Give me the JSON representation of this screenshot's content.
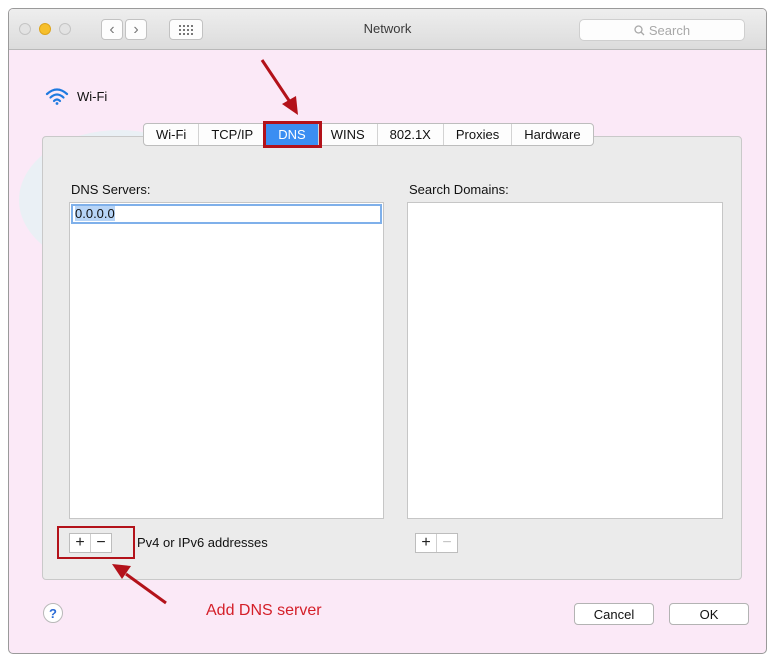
{
  "window": {
    "title": "Network",
    "search_placeholder": "Search",
    "search_icon": "magnifier-icon",
    "back_symbol": "‹",
    "forward_symbol": "›",
    "grid_icon": "grid-icon"
  },
  "header": {
    "interface_name": "Wi-Fi",
    "icon": "wifi-icon"
  },
  "tabs": [
    {
      "label": "Wi-Fi",
      "active": false
    },
    {
      "label": "TCP/IP",
      "active": false
    },
    {
      "label": "DNS",
      "active": true
    },
    {
      "label": "WINS",
      "active": false
    },
    {
      "label": "802.1X",
      "active": false
    },
    {
      "label": "Proxies",
      "active": false
    },
    {
      "label": "Hardware",
      "active": false
    }
  ],
  "dns": {
    "servers_label": "DNS Servers:",
    "servers": [
      "0.0.0.0"
    ],
    "hint": "Pv4 or IPv6 addresses",
    "add_symbol": "+",
    "remove_symbol": "−"
  },
  "search_domains": {
    "label": "Search Domains:",
    "items": [],
    "add_symbol": "+",
    "remove_symbol": "−"
  },
  "footer": {
    "help_symbol": "?",
    "cancel_label": "Cancel",
    "ok_label": "OK"
  },
  "annotation": {
    "text": "Add DNS server",
    "color": "#d41f29"
  },
  "colors": {
    "accent": "#3b8ef2",
    "highlight_box": "#b3121a",
    "background_tint": "#fbe9f7"
  }
}
